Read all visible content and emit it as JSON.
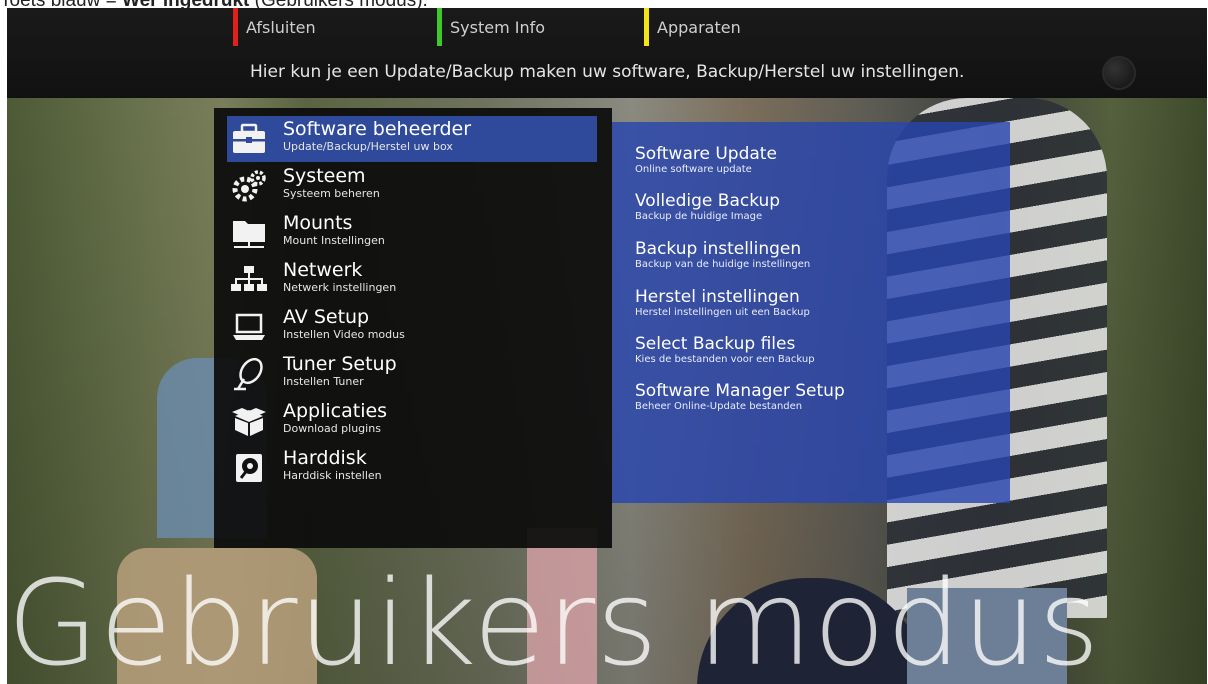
{
  "caption": {
    "prefix": "Toets blauw = ",
    "bold": "Wer ingedrukt",
    "suffix": " (Gebruikers modus)."
  },
  "colorkeys": {
    "red": {
      "label": "Afsluiten",
      "color": "#e0201b"
    },
    "green": {
      "label": "System Info",
      "color": "#3fc82a"
    },
    "yellow": {
      "label": "Apparaten",
      "color": "#f3e31a"
    }
  },
  "info_text": "Hier kun je een Update/Backup maken uw software, Backup/Herstel uw instellingen.",
  "menu": {
    "items": [
      {
        "title": "Software beheerder",
        "subtitle": "Update/Backup/Herstel uw box",
        "icon": "toolbox-icon",
        "selected": true
      },
      {
        "title": "Systeem",
        "subtitle": "Systeem beheren",
        "icon": "gears-icon"
      },
      {
        "title": "Mounts",
        "subtitle": "Mount Instellingen",
        "icon": "folder-network-icon"
      },
      {
        "title": "Netwerk",
        "subtitle": "Netwerk instellingen",
        "icon": "network-icon"
      },
      {
        "title": "AV Setup",
        "subtitle": "Instellen Video modus",
        "icon": "laptop-icon"
      },
      {
        "title": "Tuner Setup",
        "subtitle": "Instellen Tuner",
        "icon": "satellite-dish-icon"
      },
      {
        "title": "Applicaties",
        "subtitle": "Download plugins",
        "icon": "box-icon"
      },
      {
        "title": "Harddisk",
        "subtitle": "Harddisk instellen",
        "icon": "harddisk-icon"
      }
    ]
  },
  "submenu": {
    "items": [
      {
        "title": "Software Update",
        "desc": "Online software update"
      },
      {
        "title": "Volledige Backup",
        "desc": "Backup de huidige Image"
      },
      {
        "title": "Backup instellingen",
        "desc": "Backup van de huidige instellingen"
      },
      {
        "title": "Herstel instellingen",
        "desc": "Herstel instellingen uit een Backup"
      },
      {
        "title": "Select Backup files",
        "desc": "Kies de bestanden voor een Backup"
      },
      {
        "title": "Software Manager Setup",
        "desc": "Beheer Online-Update bestanden"
      }
    ]
  },
  "watermark": "Gebruikers modus",
  "colors": {
    "selected": "#2f4a9b",
    "submenu_bg": "#2846af"
  }
}
